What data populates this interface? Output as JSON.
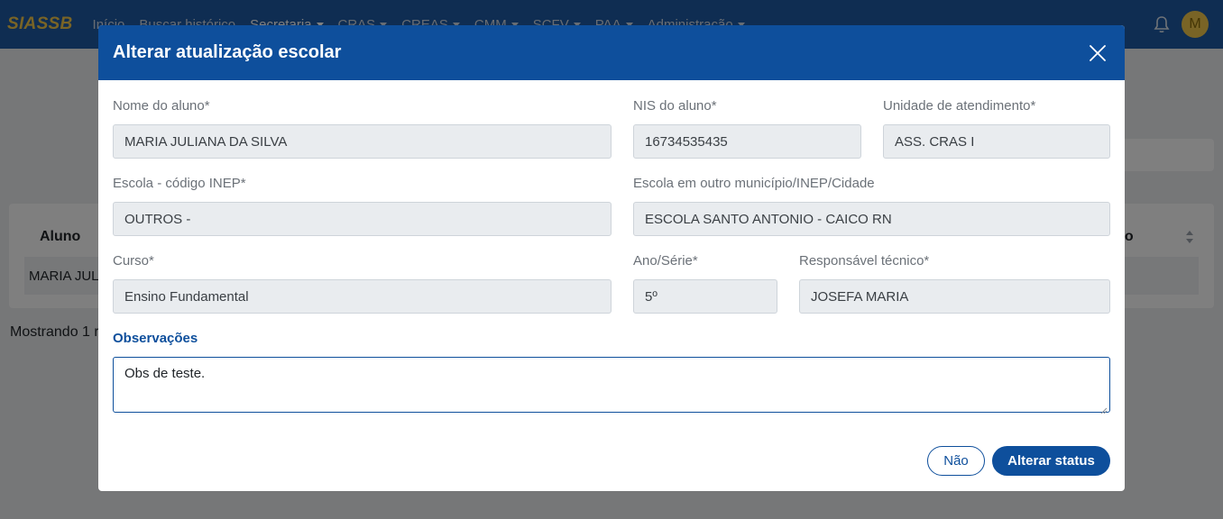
{
  "app": {
    "brand": "SIASSB",
    "nav": [
      {
        "label": "Início",
        "dropdown": false
      },
      {
        "label": "Buscar histórico",
        "dropdown": false
      },
      {
        "label": "Secretaria",
        "dropdown": true
      },
      {
        "label": "CRAS",
        "dropdown": true
      },
      {
        "label": "CREAS",
        "dropdown": true
      },
      {
        "label": "CMM",
        "dropdown": true
      },
      {
        "label": "SCFV",
        "dropdown": true
      },
      {
        "label": "PAA",
        "dropdown": true
      },
      {
        "label": "Administração",
        "dropdown": true
      }
    ],
    "avatar_initial": "M",
    "icons": {
      "notifications": "bell-icon"
    }
  },
  "background": {
    "table_header_first": "Aluno",
    "table_header_last": "ão",
    "row_first_cell": "MARIA JUL",
    "footer_text": "Mostrando 1 r"
  },
  "modal": {
    "title": "Alterar atualização escolar",
    "fields": {
      "nome_aluno": {
        "label": "Nome do aluno*",
        "value": "MARIA JULIANA DA SILVA"
      },
      "nis_aluno": {
        "label": "NIS do aluno*",
        "value": "16734535435"
      },
      "unidade": {
        "label": "Unidade de atendimento*",
        "value": "ASS. CRAS I"
      },
      "escola_inep": {
        "label": "Escola - código INEP*",
        "value": "OUTROS -"
      },
      "escola_outro": {
        "label": "Escola em outro município/INEP/Cidade",
        "value": "ESCOLA SANTO ANTONIO - CAICO RN"
      },
      "curso": {
        "label": "Curso*",
        "value": "Ensino Fundamental"
      },
      "ano_serie": {
        "label": "Ano/Série*",
        "value": "5º"
      },
      "responsavel": {
        "label": "Responsável técnico*",
        "value": "JOSEFA MARIA"
      },
      "observacoes": {
        "label": "Observações",
        "value": "Obs de teste."
      }
    },
    "buttons": {
      "no": "Não",
      "confirm": "Alterar status"
    }
  },
  "colors": {
    "primary": "#0e4f9c",
    "navbar": "#1e5aa5",
    "brand": "#f2c94c",
    "readonly_bg": "#e9ecef"
  }
}
